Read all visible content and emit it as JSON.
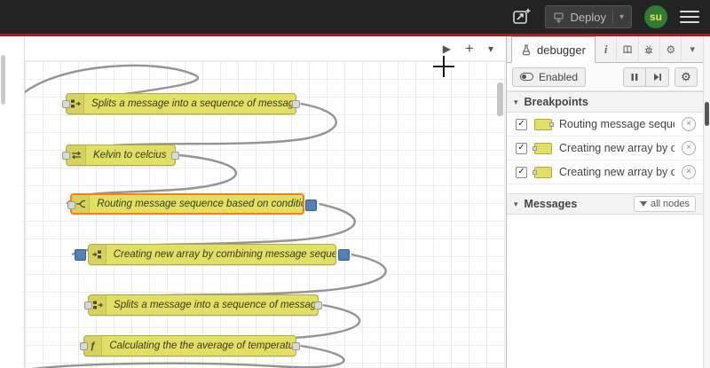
{
  "colors": {
    "accent_red": "#ad1625",
    "node_yellow": "#e3df63",
    "selected_orange": "#ff7f0e",
    "breakpoint_blue": "#4f81bd",
    "avatar_green": "#2e7d32"
  },
  "header": {
    "deploy_label": "Deploy",
    "avatar_text": "su"
  },
  "canvas_toolbar": {
    "play": "▶",
    "add": "+",
    "chevron": "▾"
  },
  "canvas": {
    "nodes": [
      {
        "label": "Splits a message into a sequence of messages.",
        "type": "split"
      },
      {
        "label": "Kelvin to celcius",
        "type": "change"
      },
      {
        "label": "Routing message sequence based on condition",
        "type": "switch",
        "selected": true,
        "paused_output": true
      },
      {
        "label": "Creating new array by combining message sequence",
        "type": "join",
        "paused_input": true,
        "paused_output": true
      },
      {
        "label": "Splits a message into a sequence of messages.",
        "type": "split"
      },
      {
        "label": "Calculating the the average of temperature",
        "type": "function"
      }
    ]
  },
  "sidebar": {
    "tab_label": "debugger",
    "enabled_label": "Enabled",
    "breakpoints_title": "Breakpoints",
    "messages_title": "Messages",
    "filter_label": "all nodes",
    "breakpoints": [
      {
        "label": "Routing message sequence based on condition"
      },
      {
        "label": "Creating new array by combining message sequence"
      },
      {
        "label": "Creating new array by combining message sequence"
      }
    ],
    "icons": {
      "gear": "⚙",
      "chevron_down": "▾",
      "check": "✓",
      "remove": "×",
      "info": "i"
    }
  }
}
